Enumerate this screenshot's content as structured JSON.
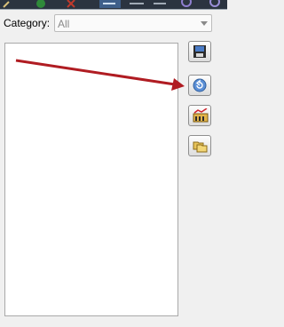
{
  "category": {
    "label": "Category:",
    "selected_value": "All"
  },
  "side_buttons": [
    {
      "icon": "save-disk-icon"
    },
    {
      "icon": "restore-icon"
    },
    {
      "icon": "chart-report-icon"
    },
    {
      "icon": "folders-icon"
    }
  ],
  "colors": {
    "annotation_arrow": "#b01c22",
    "toolbar_background": "#2b3440"
  }
}
